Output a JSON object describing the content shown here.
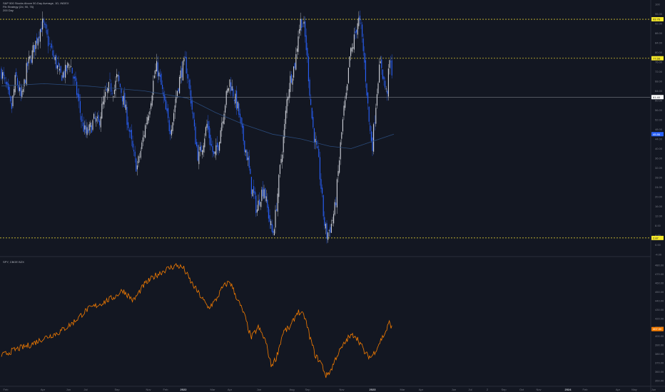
{
  "colors": {
    "background": "#131722",
    "up_body": "#d1d4dc",
    "down_body": "#2962ff",
    "ma_line": "#2a4a7a",
    "spy_line": "#f57c00",
    "dashed_level": "#d4c233",
    "current_line": "#787b86",
    "badge_yellow": "#f7e92a",
    "badge_blue": "#2962ff",
    "badge_white": "#ffffff",
    "badge_orange": "#f57c00"
  },
  "legend": {
    "line1": "S&P 500 Stocks Above 50-Day Average, 1D, INDEX",
    "line2": "Fib Strategy (2d, 90, 76)",
    "line3": "200 Day"
  },
  "spy_legend": "SPY, CBOE BZX",
  "chart_data": [
    {
      "type": "candlestick",
      "title": "S&P 500 Stocks Above 50-Day Average, 1D, INDEX",
      "y_ticks": [
        "100",
        "96.00",
        "92.00",
        "88.00",
        "84.00",
        "80.00",
        "76.00",
        "72.00",
        "68.00",
        "64.00",
        "60.00",
        "56.00",
        "52.00",
        "48.00",
        "44.00",
        "40.00",
        "36.00",
        "32.00",
        "28.00",
        "24.00",
        "20.00",
        "16.00",
        "12.00",
        "8.00",
        "4.00",
        "0.00",
        "-4.00"
      ],
      "ylim": [
        -4,
        100
      ],
      "levels": [
        {
          "value": 93.76,
          "label": "93.76",
          "style": "dashed"
        },
        {
          "value": 77.55,
          "label": "77.55",
          "style": "dashed"
        },
        {
          "value": 2.87,
          "label": "2.87",
          "style": "dashed"
        },
        {
          "value": 61.4,
          "label": "61.40",
          "style": "solid"
        }
      ],
      "ma_badge": "45.86",
      "close_waypoints": [
        [
          0,
          72
        ],
        [
          8,
          64
        ],
        [
          14,
          56
        ],
        [
          20,
          70
        ],
        [
          28,
          60
        ],
        [
          36,
          74
        ],
        [
          44,
          80
        ],
        [
          52,
          88
        ],
        [
          58,
          92
        ],
        [
          62,
          88
        ],
        [
          68,
          82
        ],
        [
          76,
          76
        ],
        [
          82,
          70
        ],
        [
          90,
          72
        ],
        [
          96,
          76
        ],
        [
          102,
          68
        ],
        [
          108,
          60
        ],
        [
          112,
          52
        ],
        [
          118,
          46
        ],
        [
          124,
          48
        ],
        [
          130,
          52
        ],
        [
          136,
          50
        ],
        [
          140,
          56
        ],
        [
          146,
          62
        ],
        [
          152,
          66
        ],
        [
          158,
          64
        ],
        [
          162,
          70
        ],
        [
          168,
          64
        ],
        [
          174,
          56
        ],
        [
          180,
          46
        ],
        [
          186,
          36
        ],
        [
          190,
          32
        ],
        [
          196,
          40
        ],
        [
          202,
          50
        ],
        [
          208,
          58
        ],
        [
          214,
          70
        ],
        [
          218,
          74
        ],
        [
          224,
          66
        ],
        [
          230,
          56
        ],
        [
          236,
          48
        ],
        [
          240,
          52
        ],
        [
          246,
          64
        ],
        [
          252,
          72
        ],
        [
          258,
          76
        ],
        [
          262,
          68
        ],
        [
          266,
          60
        ],
        [
          270,
          48
        ],
        [
          276,
          36
        ],
        [
          282,
          42
        ],
        [
          288,
          50
        ],
        [
          292,
          44
        ],
        [
          298,
          36
        ],
        [
          304,
          42
        ],
        [
          308,
          50
        ],
        [
          314,
          60
        ],
        [
          320,
          68
        ],
        [
          326,
          62
        ],
        [
          332,
          56
        ],
        [
          336,
          48
        ],
        [
          342,
          40
        ],
        [
          346,
          34
        ],
        [
          350,
          24
        ],
        [
          354,
          20
        ],
        [
          358,
          14
        ],
        [
          362,
          20
        ],
        [
          368,
          24
        ],
        [
          372,
          16
        ],
        [
          376,
          10
        ],
        [
          380,
          4
        ],
        [
          384,
          12
        ],
        [
          388,
          24
        ],
        [
          392,
          36
        ],
        [
          396,
          46
        ],
        [
          400,
          60
        ],
        [
          404,
          68
        ],
        [
          408,
          72
        ],
        [
          412,
          76
        ],
        [
          416,
          88
        ],
        [
          420,
          94
        ],
        [
          424,
          90
        ],
        [
          428,
          80
        ],
        [
          432,
          64
        ],
        [
          436,
          50
        ],
        [
          440,
          42
        ],
        [
          444,
          36
        ],
        [
          448,
          24
        ],
        [
          452,
          10
        ],
        [
          456,
          4
        ],
        [
          462,
          8
        ],
        [
          468,
          16
        ],
        [
          472,
          30
        ],
        [
          476,
          44
        ],
        [
          480,
          56
        ],
        [
          484,
          62
        ],
        [
          488,
          78
        ],
        [
          492,
          82
        ],
        [
          496,
          88
        ],
        [
          500,
          94
        ],
        [
          504,
          90
        ],
        [
          508,
          78
        ],
        [
          512,
          64
        ],
        [
          516,
          48
        ],
        [
          520,
          42
        ],
        [
          524,
          56
        ],
        [
          528,
          70
        ],
        [
          532,
          76
        ],
        [
          536,
          68
        ],
        [
          540,
          62
        ],
        [
          544,
          76
        ],
        [
          548,
          72
        ]
      ],
      "ma_waypoints": [
        [
          0,
          66
        ],
        [
          60,
          67
        ],
        [
          120,
          66
        ],
        [
          200,
          64
        ],
        [
          260,
          61
        ],
        [
          300,
          55
        ],
        [
          340,
          50
        ],
        [
          380,
          46
        ],
        [
          420,
          44
        ],
        [
          460,
          41
        ],
        [
          490,
          40
        ],
        [
          510,
          42
        ],
        [
          530,
          44
        ],
        [
          550,
          46
        ]
      ]
    },
    {
      "type": "line",
      "title": "SPY, CBOE BZX",
      "y_ticks": [
        "480.00",
        "470.00",
        "460.00",
        "450.00",
        "440.00",
        "430.00",
        "420.00",
        "410.00",
        "400.00",
        "390.00",
        "380.00",
        "370.00",
        "360.00",
        "350.00"
      ],
      "ylim": [
        345,
        485
      ],
      "last_badge": "407.00",
      "waypoints": [
        [
          0,
          378
        ],
        [
          20,
          385
        ],
        [
          40,
          390
        ],
        [
          60,
          398
        ],
        [
          80,
          404
        ],
        [
          100,
          415
        ],
        [
          120,
          430
        ],
        [
          140,
          437
        ],
        [
          160,
          445
        ],
        [
          170,
          452
        ],
        [
          185,
          440
        ],
        [
          200,
          458
        ],
        [
          215,
          468
        ],
        [
          230,
          475
        ],
        [
          245,
          480
        ],
        [
          255,
          477
        ],
        [
          265,
          462
        ],
        [
          275,
          450
        ],
        [
          290,
          432
        ],
        [
          300,
          440
        ],
        [
          310,
          455
        ],
        [
          320,
          462
        ],
        [
          330,
          443
        ],
        [
          340,
          425
        ],
        [
          350,
          398
        ],
        [
          360,
          410
        ],
        [
          370,
          395
        ],
        [
          378,
          367
        ],
        [
          385,
          375
        ],
        [
          395,
          405
        ],
        [
          405,
          410
        ],
        [
          415,
          428
        ],
        [
          425,
          422
        ],
        [
          432,
          400
        ],
        [
          440,
          378
        ],
        [
          448,
          370
        ],
        [
          455,
          355
        ],
        [
          462,
          362
        ],
        [
          470,
          378
        ],
        [
          478,
          388
        ],
        [
          486,
          398
        ],
        [
          495,
          402
        ],
        [
          503,
          392
        ],
        [
          510,
          380
        ],
        [
          518,
          376
        ],
        [
          525,
          385
        ],
        [
          532,
          396
        ],
        [
          538,
          404
        ],
        [
          544,
          416
        ],
        [
          548,
          408
        ]
      ]
    }
  ],
  "x_axis_labels": [
    {
      "label": "Feb",
      "bold": false
    },
    {
      "label": "Apr",
      "bold": false
    },
    {
      "label": "Jun",
      "bold": false
    },
    {
      "label": "Jul",
      "bold": false
    },
    {
      "label": "Sep",
      "bold": false
    },
    {
      "label": "Nov",
      "bold": false
    },
    {
      "label": "Feb",
      "bold": false
    },
    {
      "label": "2022",
      "bold": true
    },
    {
      "label": "Mar",
      "bold": false
    },
    {
      "label": "Apr",
      "bold": false
    },
    {
      "label": "Jun",
      "bold": false
    },
    {
      "label": "Aug",
      "bold": false
    },
    {
      "label": "Sep",
      "bold": false
    },
    {
      "label": "Nov",
      "bold": false
    },
    {
      "label": "2023",
      "bold": true
    },
    {
      "label": "Mar",
      "bold": false
    },
    {
      "label": "Apr",
      "bold": false
    },
    {
      "label": "Jun",
      "bold": false
    },
    {
      "label": "Jul",
      "bold": false
    },
    {
      "label": "2",
      "bold": false
    },
    {
      "label": "Sep",
      "bold": false
    },
    {
      "label": "Oct",
      "bold": false
    },
    {
      "label": "Nov",
      "bold": false
    },
    {
      "label": "2024",
      "bold": true
    },
    {
      "label": "Feb",
      "bold": false
    },
    {
      "label": "Apr",
      "bold": false
    },
    {
      "label": "May",
      "bold": false
    },
    {
      "label": "Jun",
      "bold": false
    }
  ]
}
